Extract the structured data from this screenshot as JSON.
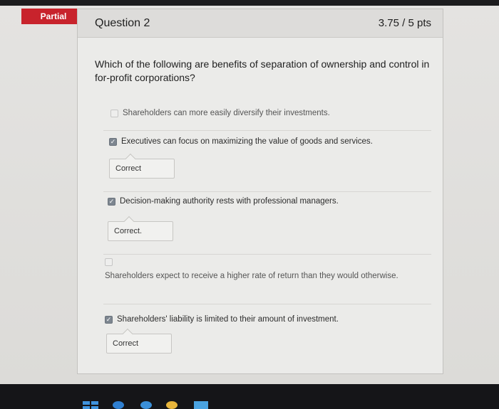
{
  "status_badge": "Partial",
  "question": {
    "title": "Question 2",
    "points": "3.75 / 5 pts",
    "prompt": "Which of the following are benefits of separation of ownership and control in for-profit corporations?"
  },
  "answers": [
    {
      "text": "Shareholders can more easily diversify their investments.",
      "checked": false,
      "feedback": ""
    },
    {
      "text": "Executives can focus on maximizing the value of goods and services.",
      "checked": true,
      "feedback": "Correct"
    },
    {
      "text": "Decision-making authority rests with professional managers.",
      "checked": true,
      "feedback": "Correct."
    },
    {
      "text": "Shareholders expect to receive a higher rate of return than they would otherwise.",
      "checked": false,
      "feedback": ""
    },
    {
      "text": "Shareholders' liability is limited to their amount of investment.",
      "checked": true,
      "feedback": "Correct"
    }
  ],
  "colors": {
    "badge": "#c8232c",
    "checkbox_checked": "#7d8690",
    "taskbar": "#151518"
  }
}
